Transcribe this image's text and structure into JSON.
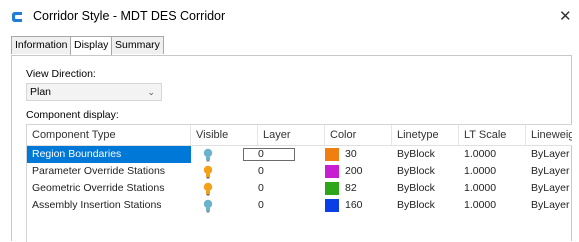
{
  "window": {
    "title": "Corridor Style - MDT DES Corridor",
    "close_glyph": "✕"
  },
  "tabs": [
    "Information",
    "Display",
    "Summary"
  ],
  "active_tab": "Display",
  "view_direction": {
    "label": "View Direction:",
    "value": "Plan"
  },
  "component_display": {
    "label": "Component display:",
    "columns": [
      "Component Type",
      "Visible",
      "Layer",
      "Color",
      "Linetype",
      "LT Scale",
      "Lineweig"
    ],
    "rows": [
      {
        "name": "Region Boundaries",
        "visible_icon": "lightbulb-off-icon",
        "layer": "0",
        "color_value": "30",
        "color_hex": "#f07f12",
        "linetype": "ByBlock",
        "lt_scale": "1.0000",
        "lineweight": "ByLayer",
        "selected": true
      },
      {
        "name": "Parameter Override Stations",
        "visible_icon": "lightbulb-on-icon",
        "layer": "0",
        "color_value": "200",
        "color_hex": "#c81ed2",
        "linetype": "ByBlock",
        "lt_scale": "1.0000",
        "lineweight": "ByLayer",
        "selected": false
      },
      {
        "name": "Geometric Override Stations",
        "visible_icon": "lightbulb-on-icon",
        "layer": "0",
        "color_value": "82",
        "color_hex": "#2ea61c",
        "linetype": "ByBlock",
        "lt_scale": "1.0000",
        "lineweight": "ByLayer",
        "selected": false
      },
      {
        "name": "Assembly Insertion Stations",
        "visible_icon": "lightbulb-off-icon",
        "layer": "0",
        "color_value": "160",
        "color_hex": "#0a3fe6",
        "linetype": "ByBlock",
        "lt_scale": "1.0000",
        "lineweight": "ByLayer",
        "selected": false
      }
    ]
  },
  "colors": {
    "selection": "#0078d7",
    "bulb_on": "#f4a11a",
    "bulb_off": "#6bb3cc",
    "app_icon": "#1f7fd6"
  }
}
